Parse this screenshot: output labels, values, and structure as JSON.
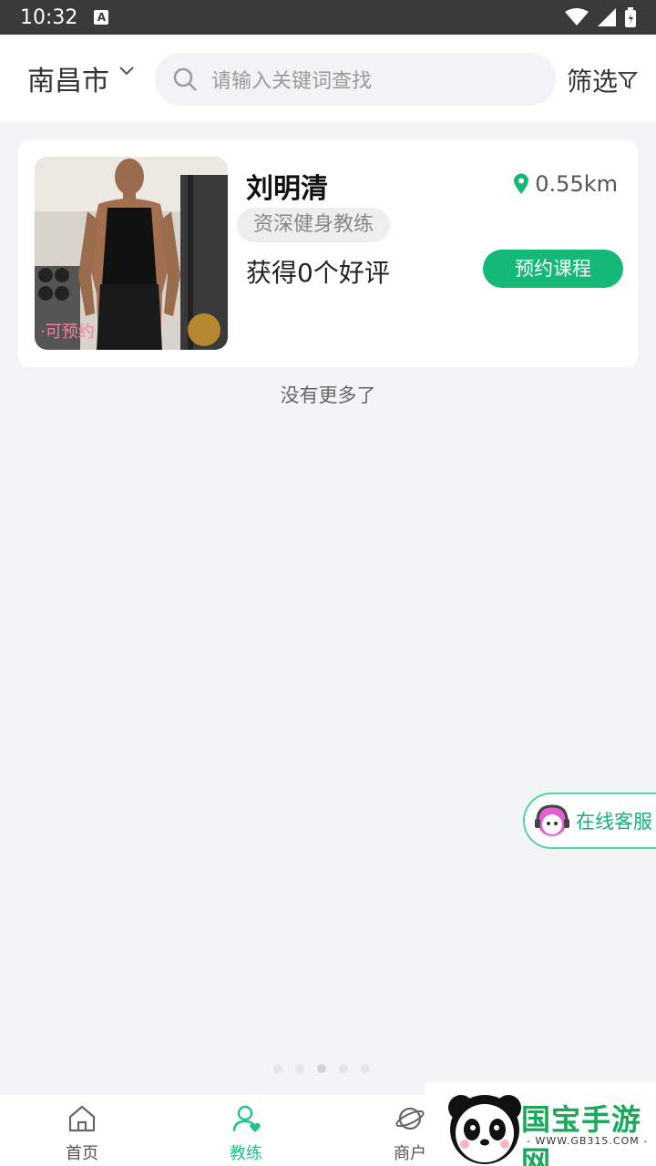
{
  "status_bar": {
    "time": "10:32",
    "notification_icon": "A"
  },
  "header": {
    "city": "南昌市",
    "search_placeholder": "请输入关键词查找",
    "filter_label": "筛选"
  },
  "coaches": [
    {
      "name": "刘明清",
      "title": "资深健身教练",
      "reviews": "获得0个好评",
      "distance": "0.55km",
      "availability": "·可预约",
      "book_label": "预约课程"
    }
  ],
  "list_end_text": "没有更多了",
  "service_label": "在线客服",
  "tabs": [
    {
      "label": "首页",
      "icon": "home-icon"
    },
    {
      "label": "教练",
      "icon": "coach-icon"
    },
    {
      "label": "商户",
      "icon": "planet-icon"
    }
  ],
  "watermark": {
    "name": "国宝手游网",
    "url": "- WWW.GB315.COM -"
  },
  "colors": {
    "primary": "#14b877",
    "active_tab": "#1cc38a",
    "badge": "#ff7d9a"
  }
}
